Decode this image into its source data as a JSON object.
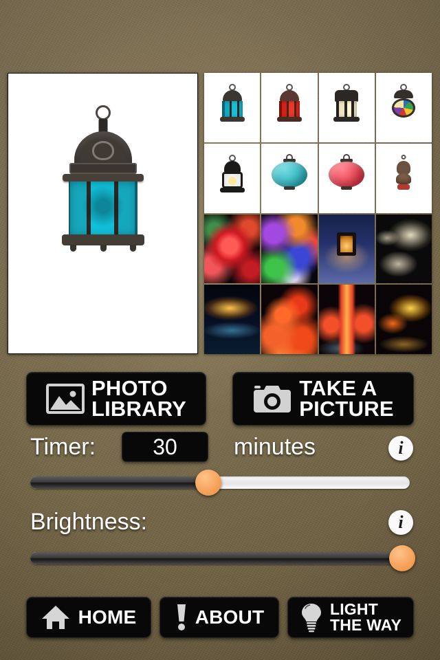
{
  "app": {
    "background_color": "#7a6a4c",
    "accent_color": "#f5a25a"
  },
  "preview": {
    "name": "selected-photo-preview",
    "description": "Moroccan style metal lantern with turquoise glass panels on white background"
  },
  "thumbnail_grid": {
    "columns": 4,
    "rows": 4,
    "items": [
      {
        "id": 1,
        "description": "Teal glass Moroccan lantern",
        "background": "#ffffff",
        "accent": "#16a7bd"
      },
      {
        "id": 2,
        "description": "Red glass Moroccan lantern",
        "background": "#ffffff",
        "accent": "#cf2418"
      },
      {
        "id": 3,
        "description": "Black hexagonal candle lantern",
        "background": "#ffffff",
        "accent": "#f0e2bc"
      },
      {
        "id": 4,
        "description": "Stained glass round lantern",
        "background": "#ffffff",
        "accent": "#3f8f4a"
      },
      {
        "id": 5,
        "description": "Black oil hurricane lantern",
        "background": "#ffffff",
        "accent": "#f2d98a"
      },
      {
        "id": 6,
        "description": "Turquoise paper ball lantern",
        "background": "#ffffff",
        "accent": "#35b8c4"
      },
      {
        "id": 7,
        "description": "Red paper ball lantern",
        "background": "#ffffff",
        "accent": "#e8414f"
      },
      {
        "id": 8,
        "description": "Ornate bronze hanging lantern",
        "background": "#ffffff",
        "accent": "#7a5a42"
      },
      {
        "id": 9,
        "description": "Red Chinese lanterns at night",
        "background": "#0a0507",
        "accent": "#e0202a"
      },
      {
        "id": 10,
        "description": "Colorful sky lanterns",
        "background": "#08060c",
        "accent": "#8b3ad6"
      },
      {
        "id": 11,
        "description": "Glowing lantern on snow",
        "background": "#121a33",
        "accent": "#ffb44c"
      },
      {
        "id": 12,
        "description": "Field of white paper lanterns",
        "background": "#0a0a0a",
        "accent": "#efe3c6"
      },
      {
        "id": 13,
        "description": "Illuminated pagoda at night",
        "background": "#05070d",
        "accent": "#ffb23a"
      },
      {
        "id": 14,
        "description": "Mass of red lanterns",
        "background": "#0b0406",
        "accent": "#ef3a18"
      },
      {
        "id": 15,
        "description": "Red lantern pillar festival",
        "background": "#0b0408",
        "accent": "#f4452c"
      },
      {
        "id": 16,
        "description": "Golden dragon lantern sculpture",
        "background": "#090507",
        "accent": "#f7a41b"
      }
    ]
  },
  "actions": {
    "photo_library_label": "PHOTO\nLIBRARY",
    "photo_library_line1": "PHOTO",
    "photo_library_line2": "LIBRARY",
    "take_picture_line1": "TAKE A",
    "take_picture_line2": "PICTURE"
  },
  "timer": {
    "label": "Timer:",
    "value": "30",
    "unit": "minutes",
    "info_glyph": "i",
    "slider_percent": 47
  },
  "brightness": {
    "label": "Brightness:",
    "info_glyph": "i",
    "slider_percent": 98
  },
  "nav": {
    "home_label": "HOME",
    "about_label": "ABOUT",
    "light_the_way_line1": "LIGHT",
    "light_the_way_line2": "THE WAY"
  }
}
